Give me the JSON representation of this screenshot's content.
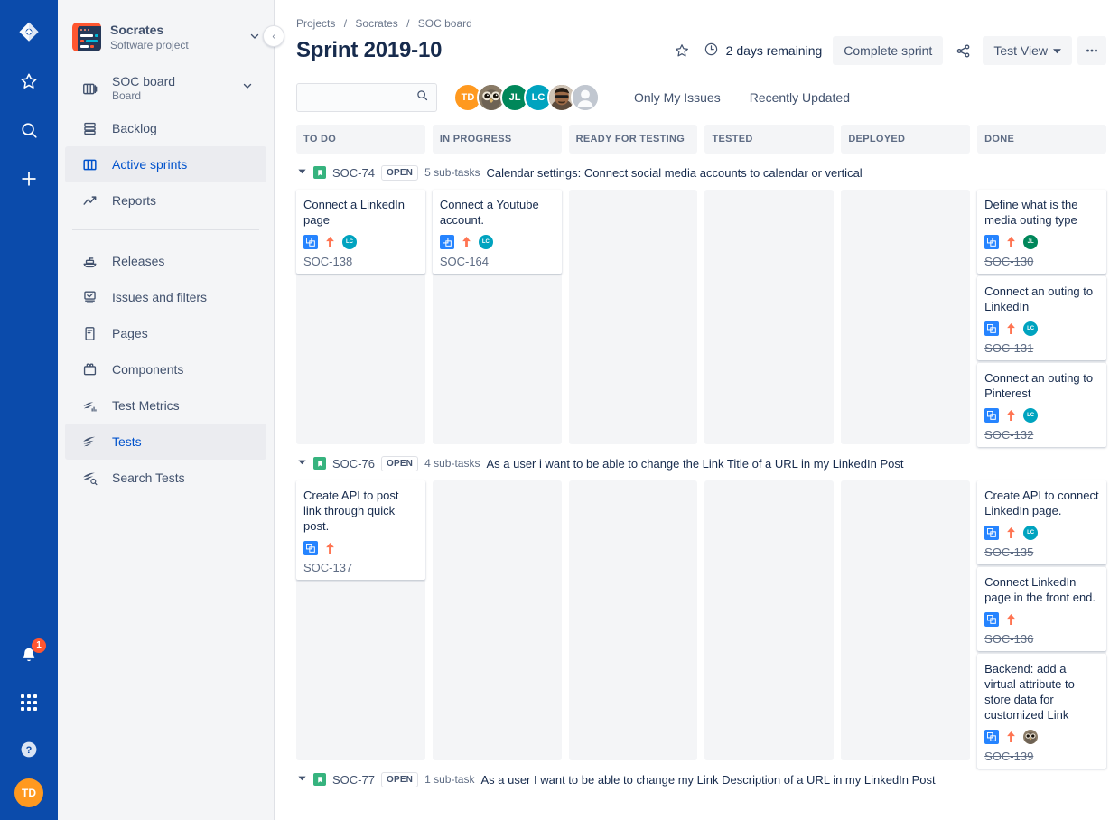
{
  "rail": {
    "logo_name": "jira-logo",
    "items": [
      {
        "name": "star-icon",
        "label": "Starred"
      },
      {
        "name": "search-icon",
        "label": "Search"
      },
      {
        "name": "create-icon",
        "label": "Create"
      }
    ],
    "notification_count": "1",
    "user_initials": "TD",
    "help_label": "?"
  },
  "sidebar": {
    "project": {
      "name": "Socrates",
      "type": "Software project",
      "chevron": "∨"
    },
    "board": {
      "name": "SOC board",
      "sub": "Board",
      "chevron": "∨"
    },
    "items": [
      {
        "label": "Backlog",
        "icon": "backlog-icon",
        "selected": false
      },
      {
        "label": "Active sprints",
        "icon": "board-icon",
        "selected": true
      },
      {
        "label": "Reports",
        "icon": "reports-icon",
        "selected": false
      }
    ],
    "items2": [
      {
        "label": "Releases",
        "icon": "releases-icon",
        "selected": false
      },
      {
        "label": "Issues and filters",
        "icon": "issues-icon",
        "selected": false
      },
      {
        "label": "Pages",
        "icon": "pages-icon",
        "selected": false
      },
      {
        "label": "Components",
        "icon": "components-icon",
        "selected": false
      },
      {
        "label": "Test Metrics",
        "icon": "test-metrics-icon",
        "selected": false
      },
      {
        "label": "Tests",
        "icon": "tests-icon",
        "selected": true
      },
      {
        "label": "Search Tests",
        "icon": "search-tests-icon",
        "selected": false
      }
    ],
    "collapse_label": "‹"
  },
  "header": {
    "breadcrumb": [
      "Projects",
      "Socrates",
      "SOC board"
    ],
    "title": "Sprint 2019-10",
    "star_label": "☆",
    "days_remaining": "2 days remaining",
    "complete_sprint_label": "Complete sprint",
    "share_label": "share-icon",
    "view_label": "Test View",
    "more_label": "•••"
  },
  "toolbar": {
    "search_value": "",
    "search_placeholder": "",
    "avatars": [
      {
        "type": "initials",
        "text": "TD",
        "color": "#ff991f"
      },
      {
        "type": "photo",
        "text": "",
        "color": "#6b5b4a"
      },
      {
        "type": "initials",
        "text": "JL",
        "color": "#00875a"
      },
      {
        "type": "initials",
        "text": "LC",
        "color": "#00a3bf"
      },
      {
        "type": "photo2",
        "text": "",
        "color": "#7a5c4b"
      },
      {
        "type": "default",
        "text": "",
        "color": "#c1c7d0"
      }
    ],
    "filters": [
      "Only My Issues",
      "Recently Updated"
    ]
  },
  "board": {
    "columns": [
      "TO DO",
      "IN PROGRESS",
      "READY FOR TESTING",
      "TESTED",
      "DEPLOYED",
      "DONE"
    ],
    "swimlanes": [
      {
        "key": "SOC-74",
        "status": "OPEN",
        "count": "5 sub-tasks",
        "title": "Calendar settings: Connect social media accounts to calendar or vertical",
        "cells": [
          [
            {
              "title": "Connect a LinkedIn page",
              "key": "SOC-138",
              "done": false,
              "avatar": {
                "type": "initials",
                "text": "LC",
                "color": "#00a3bf"
              }
            }
          ],
          [
            {
              "title": "Connect a Youtube account.",
              "key": "SOC-164",
              "done": false,
              "avatar": {
                "type": "initials",
                "text": "LC",
                "color": "#00a3bf"
              }
            }
          ],
          [],
          [],
          [],
          [
            {
              "title": "Define what is the media outing type",
              "key": "SOC-130",
              "done": true,
              "avatar": {
                "type": "initials",
                "text": "JL",
                "color": "#00875a"
              }
            },
            {
              "title": "Connect an outing to LinkedIn",
              "key": "SOC-131",
              "done": true,
              "avatar": {
                "type": "initials",
                "text": "LC",
                "color": "#00a3bf"
              }
            },
            {
              "title": "Connect an outing to Pinterest",
              "key": "SOC-132",
              "done": true,
              "avatar": {
                "type": "initials",
                "text": "LC",
                "color": "#00a3bf"
              }
            }
          ]
        ]
      },
      {
        "key": "SOC-76",
        "status": "OPEN",
        "count": "4 sub-tasks",
        "title": "As a user i want to be able to change the Link Title of a URL in my LinkedIn Post",
        "cells": [
          [
            {
              "title": "Create API to post link through quick post.",
              "key": "SOC-137",
              "done": false,
              "avatar": null
            }
          ],
          [],
          [],
          [],
          [],
          [
            {
              "title": "Create API to connect LinkedIn page.",
              "key": "SOC-135",
              "done": true,
              "avatar": {
                "type": "initials",
                "text": "LC",
                "color": "#00a3bf"
              }
            },
            {
              "title": "Connect LinkedIn page in the front end.",
              "key": "SOC-136",
              "done": true,
              "avatar": null
            },
            {
              "title": "Backend: add a virtual attribute to store data for customized Link",
              "key": "SOC-139",
              "done": true,
              "avatar": {
                "type": "photo",
                "text": "",
                "color": "#6b5b4a"
              }
            }
          ]
        ]
      },
      {
        "key": "SOC-77",
        "status": "OPEN",
        "count": "1 sub-task",
        "title": "As a user I want to be able to change my Link Description of a URL in my LinkedIn Post",
        "cells": [
          [],
          [],
          [],
          [],
          [],
          []
        ]
      }
    ]
  },
  "colors": {
    "brand_blue": "#0b4bab",
    "link_blue": "#0052cc",
    "sidebar_bg": "#f4f5f7",
    "done_green": "#36b37e",
    "priority_orange": "#ff7452",
    "subtask_blue": "#2684ff"
  }
}
